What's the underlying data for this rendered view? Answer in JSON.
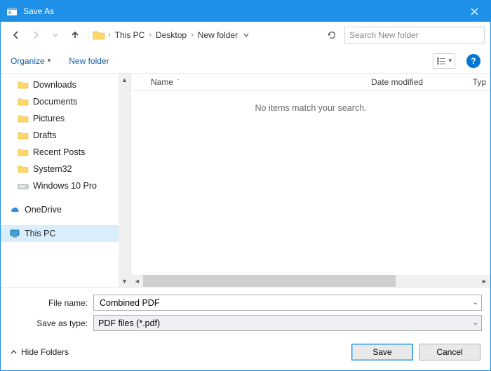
{
  "titlebar": {
    "title": "Save As"
  },
  "nav": {
    "breadcrumb": [
      "This PC",
      "Desktop",
      "New folder"
    ],
    "search_placeholder": "Search New folder"
  },
  "toolbar": {
    "organize": "Organize",
    "newfolder": "New folder"
  },
  "tree": {
    "items": [
      {
        "label": "Downloads",
        "icon": "folder",
        "pinned": true
      },
      {
        "label": "Documents",
        "icon": "folder",
        "pinned": true
      },
      {
        "label": "Pictures",
        "icon": "folder",
        "pinned": true
      },
      {
        "label": "Drafts",
        "icon": "folder",
        "pinned": false
      },
      {
        "label": "Recent Posts",
        "icon": "folder",
        "pinned": false
      },
      {
        "label": "System32",
        "icon": "folder",
        "pinned": false
      },
      {
        "label": "Windows 10 Pro",
        "icon": "drive",
        "pinned": false
      },
      {
        "label": "OneDrive",
        "icon": "onedrive",
        "pinned": false,
        "spaced": true
      },
      {
        "label": "This PC",
        "icon": "thispc",
        "pinned": false,
        "selected": true,
        "spaced": true
      }
    ]
  },
  "columns": {
    "name": "Name",
    "date": "Date modified",
    "type": "Typ"
  },
  "empty_message": "No items match your search.",
  "fields": {
    "filename_label": "File name:",
    "filename_value": "Combined PDF",
    "savetype_label": "Save as type:",
    "savetype_value": "PDF files (*.pdf)"
  },
  "footer": {
    "hide_folders": "Hide Folders",
    "save": "Save",
    "cancel": "Cancel"
  }
}
